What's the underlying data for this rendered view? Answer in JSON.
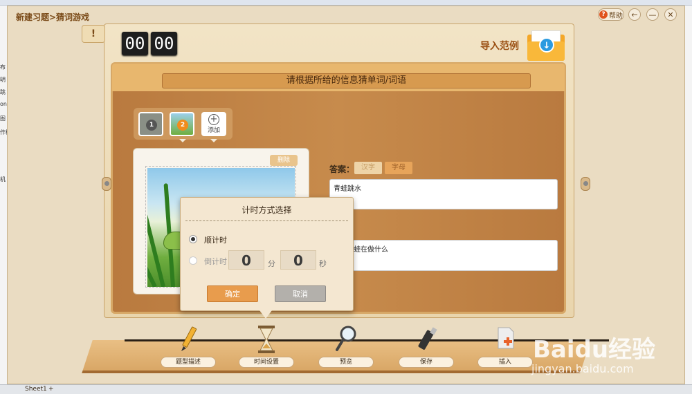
{
  "window": {
    "title": "新建习题>猜词游戏",
    "help_label": "帮助",
    "back_icon": "arrow-left-icon",
    "minimize_icon": "minimize-icon",
    "close_icon": "close-icon"
  },
  "timer": {
    "minutes": "00",
    "seconds": "00"
  },
  "import": {
    "label": "导入范例",
    "icon": "download-folder-icon"
  },
  "prompt": "请根据所给的信息猜单词/词语",
  "thumbnails": [
    {
      "number": "1",
      "badge_color": "#555555"
    },
    {
      "number": "2",
      "badge_color": "#f28c1c"
    }
  ],
  "add_label": "添加",
  "image_card": {
    "delete_label": "删除"
  },
  "answer": {
    "label": "答案：",
    "tab_hanzi": "汉字",
    "tab_letter": "字母",
    "value": "青蛙跳水",
    "hint_value": "青蛙在做什么"
  },
  "modal": {
    "title": "计时方式选择",
    "option_countup": "顺计时",
    "option_countdown": "倒计时",
    "minutes_value": "0",
    "minutes_unit": "分",
    "seconds_value": "0",
    "seconds_unit": "秒",
    "confirm_label": "确定",
    "cancel_label": "取消",
    "selected_option": "顺计时"
  },
  "toolbar": [
    {
      "label": "题型描述",
      "icon": "pencil-icon"
    },
    {
      "label": "时间设置",
      "icon": "hourglass-icon"
    },
    {
      "label": "预览",
      "icon": "magnifier-icon"
    },
    {
      "label": "保存",
      "icon": "usb-drive-icon"
    },
    {
      "label": "插入",
      "icon": "insert-document-icon"
    }
  ],
  "background_app": {
    "sheet_tab": "Sheet1",
    "left_labels": [
      "布",
      "明",
      "跳",
      "on",
      "图",
      "作框",
      "机"
    ]
  },
  "watermark": {
    "brand": "Baidu经验",
    "url": "jingyan.baidu.com"
  },
  "colors": {
    "accent_orange": "#e89c4d",
    "title_brown": "#7a4a18",
    "wood": "#c78b4c"
  }
}
